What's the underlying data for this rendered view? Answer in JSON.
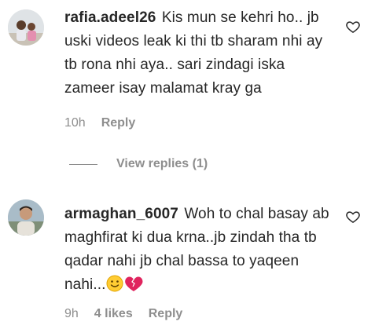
{
  "comments": [
    {
      "username": "rafia.adeel26",
      "text": "Kis mun se kehri ho.. jb uski videos leak ki thi tb sharam nhi ay tb rona nhi aya.. sari zindagi iska zameer isay malamat kray ga",
      "time": "10h",
      "reply_label": "Reply",
      "view_replies": "View replies (1)"
    },
    {
      "username": "armaghan_6007",
      "text": "Woh to chal basay ab maghfirat ki dua krna..jb zindah tha tb qadar nahi jb chal bassa to yaqeen nahi...",
      "time": "9h",
      "likes": "4 likes",
      "reply_label": "Reply",
      "emojis": [
        "slightly-smiling-face",
        "broken-heart"
      ]
    }
  ],
  "colors": {
    "text": "#262626",
    "secondary": "#8e8e8e",
    "broken_heart": "#e0245e"
  }
}
